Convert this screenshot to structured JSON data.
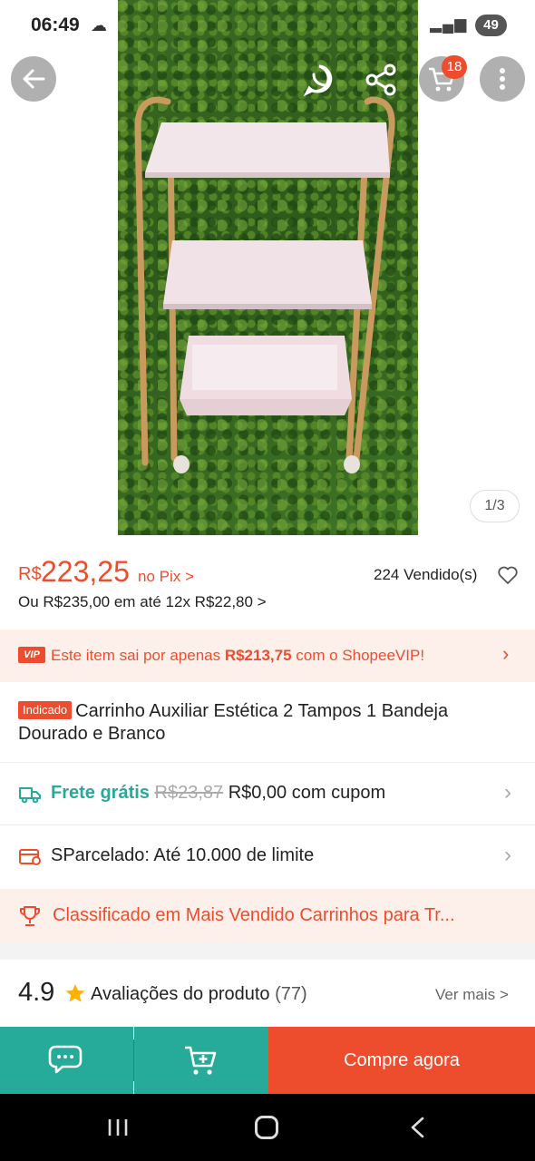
{
  "status_bar": {
    "time": "06:49",
    "battery": "49"
  },
  "header": {
    "cart_count": "18"
  },
  "gallery": {
    "pager": "1/3"
  },
  "price": {
    "currency": "R$",
    "amount": "223,25",
    "pix_label": "no Pix >",
    "installments": "Ou R$235,00 em até 12x R$22,80 >",
    "sold": "224 Vendido(s)"
  },
  "vip_banner": {
    "badge": "VIP",
    "text_prefix": "Este item sai por apenas ",
    "vip_price": "R$213,75",
    "text_suffix": " com o ShopeeVIP!"
  },
  "product": {
    "tag": "Indicado",
    "title": "Carrinho Auxiliar Estética 2 Tampos 1 Bandeja Dourado e Branco"
  },
  "shipping": {
    "free_label": "Frete grátis",
    "old_price": "R$23,87",
    "new_price": "R$0,00 com cupom"
  },
  "credit": {
    "label": "SParcelado: Até 10.000 de limite"
  },
  "ranking": {
    "label": "Classificado em Mais Vendido Carrinhos para Tr..."
  },
  "reviews": {
    "rating": "4.9",
    "label": "Avaliações do produto",
    "count": "(77)",
    "see_more": "Ver mais >"
  },
  "actions": {
    "buy_now": "Compre agora"
  },
  "colors": {
    "brand": "#ee4d2d",
    "teal": "#26aa99",
    "vip_bg": "#fdf0ea"
  }
}
